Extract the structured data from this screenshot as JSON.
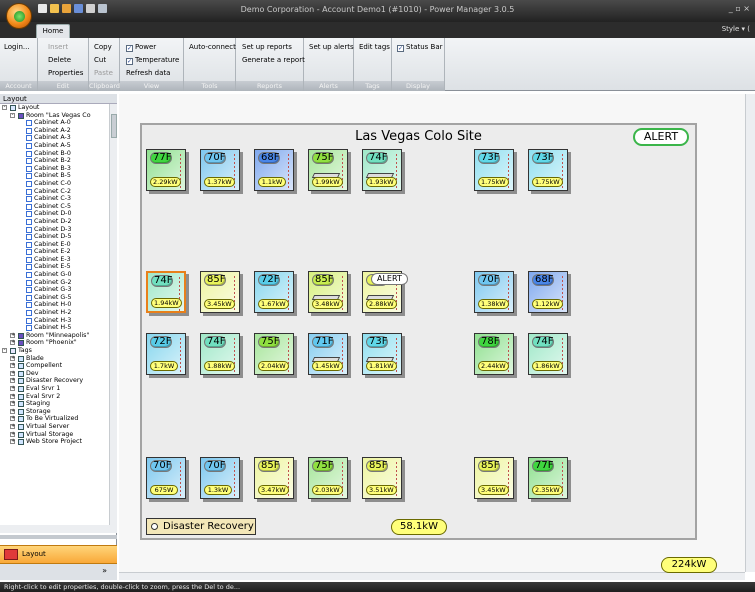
{
  "window": {
    "title": "Demo Corporation - Account Demo1 (#1010) - Power Manager 3.0.5",
    "controls": "_ ▫ ×",
    "style_menu": "Style ▾ ("
  },
  "ribbon": {
    "tab": "Home",
    "groups": [
      {
        "label": "Account",
        "items": [
          "Login..."
        ],
        "disabled": []
      },
      {
        "label": "Edit",
        "items": [
          "Insert",
          "Delete",
          "Properties"
        ],
        "disabled": [
          "Insert"
        ]
      },
      {
        "label": "Clipboard",
        "items": [
          "Copy",
          "Cut",
          "Paste"
        ],
        "disabled": [
          "Paste"
        ]
      },
      {
        "label": "View",
        "items": [
          "Power",
          "Temperature",
          "Refresh data"
        ],
        "checked": [
          "Power",
          "Temperature"
        ]
      },
      {
        "label": "Tools",
        "items": [
          "Auto-connect"
        ]
      },
      {
        "label": "Reports",
        "items": [
          "Set up reports",
          "Generate a report"
        ]
      },
      {
        "label": "Alerts",
        "items": [
          "Set up alerts"
        ]
      },
      {
        "label": "Tags",
        "items": [
          "Edit tags"
        ]
      },
      {
        "label": "Display",
        "items": [
          "Status Bar"
        ],
        "checked": [
          "Status Bar"
        ]
      }
    ]
  },
  "tree": {
    "header": "Layout",
    "rows": [
      {
        "label": "Layout",
        "level": 0,
        "type": "home",
        "exp": "-"
      },
      {
        "label": "Room \"Las Vegas Co",
        "level": 1,
        "type": "room",
        "exp": "-"
      },
      {
        "label": "Cabinet A-0",
        "level": 2,
        "type": "cab"
      },
      {
        "label": "Cabinet A-2",
        "level": 2,
        "type": "cab"
      },
      {
        "label": "Cabinet A-3",
        "level": 2,
        "type": "cab"
      },
      {
        "label": "Cabinet A-5",
        "level": 2,
        "type": "cab"
      },
      {
        "label": "Cabinet B-0",
        "level": 2,
        "type": "cab"
      },
      {
        "label": "Cabinet B-2",
        "level": 2,
        "type": "cab"
      },
      {
        "label": "Cabinet B-3",
        "level": 2,
        "type": "cab"
      },
      {
        "label": "Cabinet B-5",
        "level": 2,
        "type": "cab"
      },
      {
        "label": "Cabinet C-0",
        "level": 2,
        "type": "cab"
      },
      {
        "label": "Cabinet C-2",
        "level": 2,
        "type": "cab"
      },
      {
        "label": "Cabinet C-3",
        "level": 2,
        "type": "cab"
      },
      {
        "label": "Cabinet C-5",
        "level": 2,
        "type": "cab"
      },
      {
        "label": "Cabinet D-0",
        "level": 2,
        "type": "cab"
      },
      {
        "label": "Cabinet D-2",
        "level": 2,
        "type": "cab"
      },
      {
        "label": "Cabinet D-3",
        "level": 2,
        "type": "cab"
      },
      {
        "label": "Cabinet D-5",
        "level": 2,
        "type": "cab"
      },
      {
        "label": "Cabinet E-0",
        "level": 2,
        "type": "cab"
      },
      {
        "label": "Cabinet E-2",
        "level": 2,
        "type": "cab"
      },
      {
        "label": "Cabinet E-3",
        "level": 2,
        "type": "cab"
      },
      {
        "label": "Cabinet E-5",
        "level": 2,
        "type": "cab"
      },
      {
        "label": "Cabinet G-0",
        "level": 2,
        "type": "cab"
      },
      {
        "label": "Cabinet G-2",
        "level": 2,
        "type": "cab"
      },
      {
        "label": "Cabinet G-3",
        "level": 2,
        "type": "cab"
      },
      {
        "label": "Cabinet G-5",
        "level": 2,
        "type": "cab"
      },
      {
        "label": "Cabinet H-0",
        "level": 2,
        "type": "cab"
      },
      {
        "label": "Cabinet H-2",
        "level": 2,
        "type": "cab"
      },
      {
        "label": "Cabinet H-3",
        "level": 2,
        "type": "cab"
      },
      {
        "label": "Cabinet H-5",
        "level": 2,
        "type": "cab"
      },
      {
        "label": "Room \"Minneapolis\"",
        "level": 1,
        "type": "room",
        "exp": "+"
      },
      {
        "label": "Room \"Phoenix\"",
        "level": 1,
        "type": "room",
        "exp": "+"
      },
      {
        "label": "Tags",
        "level": 0,
        "type": "tags",
        "exp": "-"
      },
      {
        "label": "Blade",
        "level": 1,
        "type": "tag",
        "exp": "+"
      },
      {
        "label": "Compellent",
        "level": 1,
        "type": "tag",
        "exp": "+"
      },
      {
        "label": "Dev",
        "level": 1,
        "type": "tag",
        "exp": "+"
      },
      {
        "label": "Disaster Recovery",
        "level": 1,
        "type": "tag",
        "exp": "+"
      },
      {
        "label": "Eval Srvr 1",
        "level": 1,
        "type": "tag",
        "exp": "+"
      },
      {
        "label": "Eval Srvr 2",
        "level": 1,
        "type": "tag",
        "exp": "+"
      },
      {
        "label": "Staging",
        "level": 1,
        "type": "tag",
        "exp": "+"
      },
      {
        "label": "Storage",
        "level": 1,
        "type": "tag",
        "exp": "+"
      },
      {
        "label": "To Be Virtualized",
        "level": 1,
        "type": "tag",
        "exp": "+"
      },
      {
        "label": "Virtual Server",
        "level": 1,
        "type": "tag",
        "exp": "+"
      },
      {
        "label": "Virtual Storage",
        "level": 1,
        "type": "tag",
        "exp": "+"
      },
      {
        "label": "Web Store Project",
        "level": 1,
        "type": "tag",
        "exp": "+"
      }
    ]
  },
  "nav": {
    "layout": "Layout",
    "grip": "..........",
    "more": "»"
  },
  "room": {
    "title": "Las Vegas Colo Site",
    "alert": "ALERT",
    "tag": "Disaster Recovery",
    "total": "58.1kW"
  },
  "site_total": "224kW",
  "cabinets": [
    {
      "temp": "77F",
      "power": "2.29kW",
      "temp_color": "#3fd63f",
      "body_color": "#8fe08f"
    },
    {
      "temp": "70F",
      "power": "1.37kW",
      "temp_color": "#6fc6f0",
      "body_color": "#7ec8ef"
    },
    {
      "temp": "68F",
      "power": "1.1kW",
      "temp_color": "#4a86e8",
      "body_color": "#7fa8ee"
    },
    {
      "temp": "75F",
      "power": "1.99kW",
      "temp_color": "#90e040",
      "body_color": "#a6e59a",
      "conn": true
    },
    {
      "temp": "74F",
      "power": "1.93kW",
      "temp_color": "#70e0c0",
      "body_color": "#9fe8c8",
      "conn": true
    },
    {
      "temp": "73F",
      "power": "1.75kW",
      "temp_color": "#60d8e8",
      "body_color": "#8fdff0"
    },
    {
      "temp": "73F",
      "power": "1.75kW",
      "temp_color": "#60d8e8",
      "body_color": "#8fdff0"
    },
    {
      "temp": "74F",
      "power": "1.94kW",
      "temp_color": "#70e0c0",
      "body_color": "#9fe8c8",
      "selected": true
    },
    {
      "temp": "85F",
      "power": "3.45kW",
      "temp_color": "#e8f45a",
      "body_color": "#eef5a0"
    },
    {
      "temp": "72F",
      "power": "1.67kW",
      "temp_color": "#58cce8",
      "body_color": "#86d6ee"
    },
    {
      "temp": "85F",
      "power": "3.48kW",
      "temp_color": "#c8ee50",
      "body_color": "#d8f07e",
      "conn": true
    },
    {
      "temp": "",
      "power": "2.88kW",
      "temp_color": "#e8f45a",
      "body_color": "#eef5a0",
      "alert": "ALERT",
      "conn": true
    },
    {
      "temp": "70F",
      "power": "1.38kW",
      "temp_color": "#6fc6f0",
      "body_color": "#7ec8ef"
    },
    {
      "temp": "68F",
      "power": "1.12kW",
      "temp_color": "#4a86e8",
      "body_color": "#7fa8ee"
    },
    {
      "temp": "72F",
      "power": "1.7kW",
      "temp_color": "#58cce8",
      "body_color": "#86d6ee"
    },
    {
      "temp": "74F",
      "power": "1.88kW",
      "temp_color": "#70e0c0",
      "body_color": "#9fe8c8"
    },
    {
      "temp": "75F",
      "power": "2.04kW",
      "temp_color": "#90e040",
      "body_color": "#a6e59a"
    },
    {
      "temp": "71F",
      "power": "1.45kW",
      "temp_color": "#60c8f0",
      "body_color": "#86cdf0",
      "conn": true
    },
    {
      "temp": "73F",
      "power": "1.81kW",
      "temp_color": "#60d8e8",
      "body_color": "#8fdff0",
      "conn": true
    },
    {
      "temp": "78F",
      "power": "2.44kW",
      "temp_color": "#3fd63f",
      "body_color": "#8fe08f"
    },
    {
      "temp": "74F",
      "power": "1.86kW",
      "temp_color": "#70e0c0",
      "body_color": "#9fe8c8"
    },
    {
      "temp": "70F",
      "power": "675W",
      "temp_color": "#6fc6f0",
      "body_color": "#7ec8ef"
    },
    {
      "temp": "70F",
      "power": "1.3kW",
      "temp_color": "#6fc6f0",
      "body_color": "#7ec8ef"
    },
    {
      "temp": "85F",
      "power": "3.47kW",
      "temp_color": "#e8f45a",
      "body_color": "#eef5a0"
    },
    {
      "temp": "75F",
      "power": "2.03kW",
      "temp_color": "#90e040",
      "body_color": "#a6e59a"
    },
    {
      "temp": "85F",
      "power": "3.51kW",
      "temp_color": "#e8f45a",
      "body_color": "#eef5a0"
    },
    {
      "temp": "85F",
      "power": "3.45kW",
      "temp_color": "#e8f45a",
      "body_color": "#eef5a0"
    },
    {
      "temp": "77F",
      "power": "2.35kW",
      "temp_color": "#3fd63f",
      "body_color": "#8fe08f"
    }
  ],
  "status": "Right-click to edit properties, double-click to zoom, press the Del to de..."
}
